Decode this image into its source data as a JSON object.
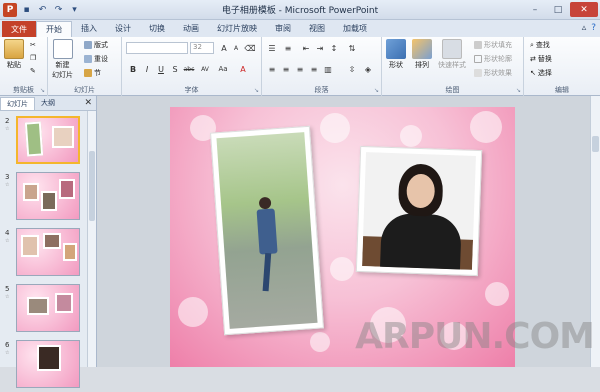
{
  "window": {
    "title": "电子相册模板 - Microsoft PowerPoint",
    "app_icon_letter": "P",
    "controls": [
      "–",
      "□",
      "✕"
    ]
  },
  "qat": {
    "icons": [
      "save-icon",
      "undo-icon",
      "redo-icon",
      "customize-icon"
    ]
  },
  "ribbon_tabs": {
    "file": "文件",
    "items": [
      "开始",
      "插入",
      "设计",
      "切换",
      "动画",
      "幻灯片放映",
      "审阅",
      "视图",
      "加载项"
    ],
    "active_index": 0
  },
  "clipboard": {
    "paste": "粘贴",
    "label": "剪贴板"
  },
  "slides_group": {
    "new_slide": "新建\n幻灯片",
    "layout": "版式",
    "reset": "重设",
    "section": "节",
    "label": "幻灯片"
  },
  "font_group": {
    "font_name": "",
    "font_size": "32",
    "label": "字体",
    "buttons": [
      "B",
      "I",
      "U",
      "S",
      "abc",
      "AV",
      "Aa",
      "A"
    ]
  },
  "paragraph_group": {
    "label": "段落"
  },
  "drawing_group": {
    "shape": "形状",
    "arrange": "排列",
    "quick_styles": "快速样式",
    "fill": "形状填充",
    "outline": "形状轮廓",
    "effects": "形状效果",
    "label": "绘图"
  },
  "editing_group": {
    "find": "查找",
    "replace": "替换",
    "select": "选择",
    "label": "编辑"
  },
  "panel": {
    "tab_slides": "幻灯片",
    "tab_outline": "大纲",
    "close": "✕"
  },
  "slides": [
    {
      "num": "2",
      "selected": true
    },
    {
      "num": "3",
      "selected": false
    },
    {
      "num": "4",
      "selected": false
    },
    {
      "num": "5",
      "selected": false
    },
    {
      "num": "6",
      "selected": false
    }
  ],
  "slide_star": "☆",
  "watermark": "ARPUN.COM",
  "colors": {
    "file_tab": "#c4412a",
    "accent": "#f4b62c"
  }
}
